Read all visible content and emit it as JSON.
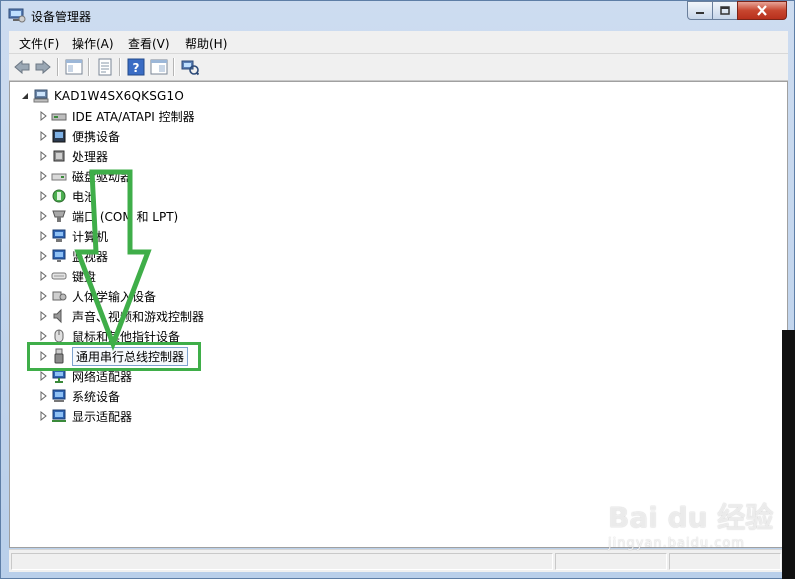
{
  "window": {
    "title": "设备管理器"
  },
  "menu": [
    "文件(F)",
    "操作(A)",
    "查看(V)",
    "帮助(H)"
  ],
  "tree": {
    "root": "KAD1W4SX6QKSG1O",
    "items": [
      {
        "label": "IDE ATA/ATAPI 控制器",
        "icon": "ide-controller-icon"
      },
      {
        "label": "便携设备",
        "icon": "portable-device-icon"
      },
      {
        "label": "处理器",
        "icon": "processor-icon"
      },
      {
        "label": "磁盘驱动器",
        "icon": "disk-drive-icon"
      },
      {
        "label": "电池",
        "icon": "battery-icon"
      },
      {
        "label": "端口 (COM 和 LPT)",
        "icon": "port-icon"
      },
      {
        "label": "计算机",
        "icon": "computer-icon"
      },
      {
        "label": "监视器",
        "icon": "monitor-icon"
      },
      {
        "label": "键盘",
        "icon": "keyboard-icon"
      },
      {
        "label": "人体学输入设备",
        "icon": "hid-icon"
      },
      {
        "label": "声音、视频和游戏控制器",
        "icon": "sound-icon"
      },
      {
        "label": "鼠标和其他指针设备",
        "icon": "mouse-icon"
      },
      {
        "label": "通用串行总线控制器",
        "icon": "usb-icon"
      },
      {
        "label": "网络适配器",
        "icon": "network-adapter-icon"
      },
      {
        "label": "系统设备",
        "icon": "system-device-icon"
      },
      {
        "label": "显示适配器",
        "icon": "display-adapter-icon"
      }
    ]
  },
  "selected_item": "通用串行总线控制器",
  "annotation_color": "#3fae49",
  "watermark": {
    "main": "Bai du 经验",
    "sub": "jingyan.baidu.com"
  }
}
